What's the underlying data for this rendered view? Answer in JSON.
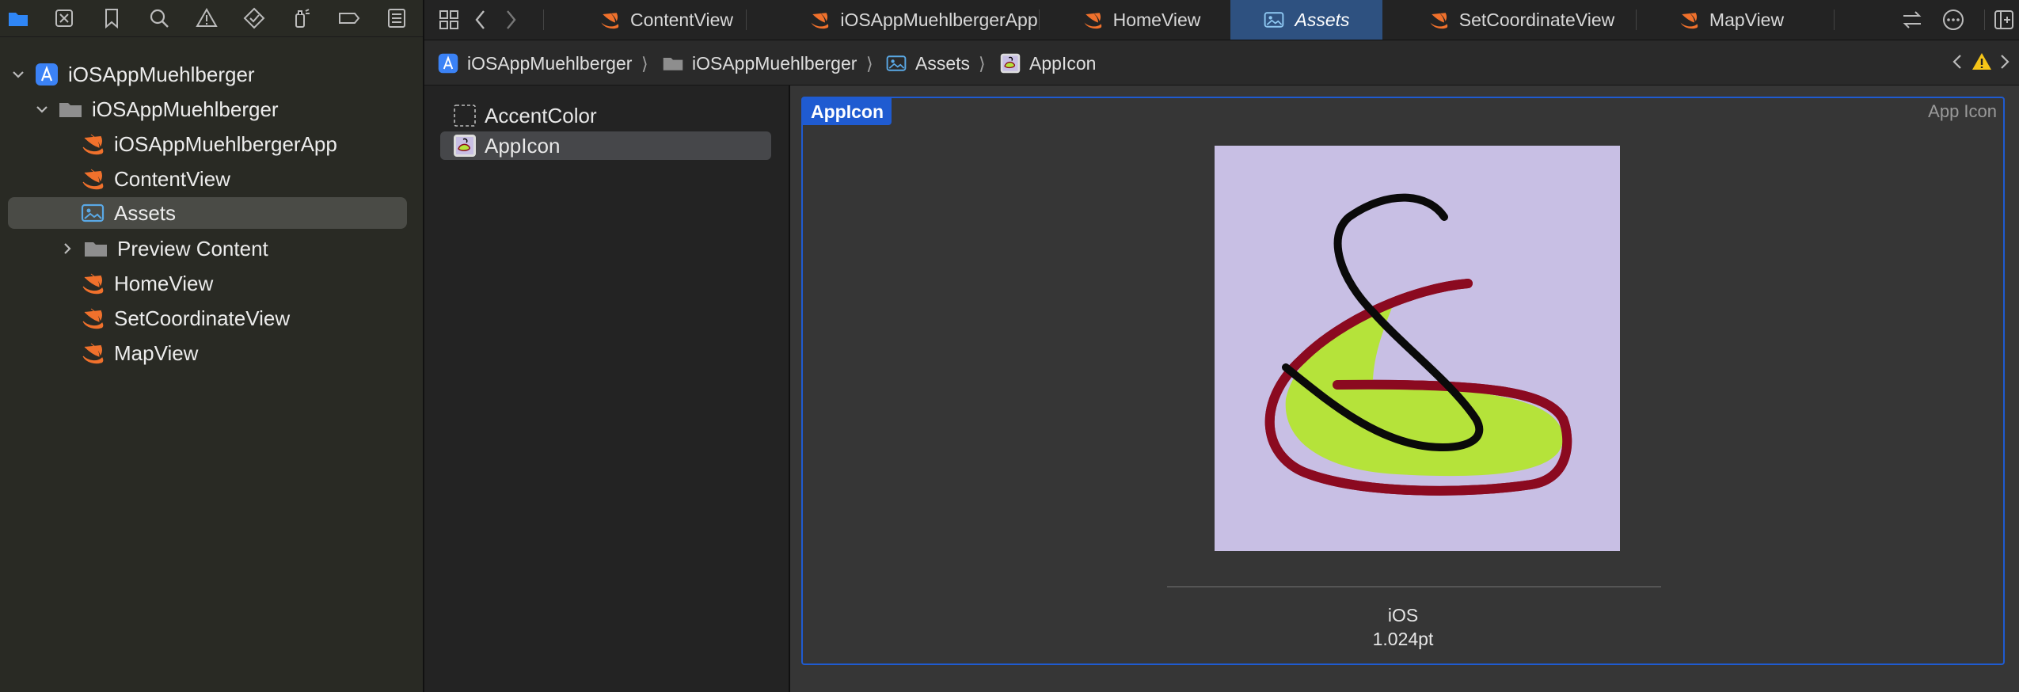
{
  "navigator": {
    "project": "iOSAppMuehlberger",
    "group": "iOSAppMuehlberger",
    "items": [
      {
        "label": "iOSAppMuehlbergerApp",
        "icon": "swift-file-icon"
      },
      {
        "label": "ContentView",
        "icon": "swift-file-icon"
      },
      {
        "label": "Assets",
        "icon": "asset-catalog-icon",
        "selected": true
      },
      {
        "label": "Preview Content",
        "icon": "folder-icon",
        "collapsed": true
      },
      {
        "label": "HomeView",
        "icon": "swift-file-icon"
      },
      {
        "label": "SetCoordinateView",
        "icon": "swift-file-icon"
      },
      {
        "label": "MapView",
        "icon": "swift-file-icon"
      }
    ]
  },
  "tabs": [
    {
      "label": "ContentView",
      "icon": "swift-file-icon"
    },
    {
      "label": "iOSAppMuehlbergerApp",
      "icon": "swift-file-icon"
    },
    {
      "label": "HomeView",
      "icon": "swift-file-icon"
    },
    {
      "label": "Assets",
      "icon": "asset-catalog-icon",
      "active": true
    },
    {
      "label": "SetCoordinateView",
      "icon": "swift-file-icon"
    },
    {
      "label": "MapView",
      "icon": "swift-file-icon"
    }
  ],
  "breadcrumb": [
    "iOSAppMuehlberger",
    "iOSAppMuehlberger",
    "Assets",
    "AppIcon"
  ],
  "breadcrumb_separator": "⟩",
  "assets": [
    {
      "label": "AccentColor",
      "icon": "color-set-icon"
    },
    {
      "label": "AppIcon",
      "icon": "app-icon-set-icon",
      "selected": true
    }
  ],
  "editor": {
    "set_name": "AppIcon",
    "set_type": "App Icon",
    "slot_platform": "iOS",
    "slot_size": "1.024pt"
  },
  "colors": {
    "accent": "#1f5bd1",
    "swift": "#f0712c",
    "folder": "#8e8e8e",
    "warning": "#f5c518",
    "icon_background": "#c8bfe4",
    "icon_fill": "#b5e33a",
    "icon_outline": "#8b0a20",
    "icon_stroke": "#0a0a0a"
  }
}
